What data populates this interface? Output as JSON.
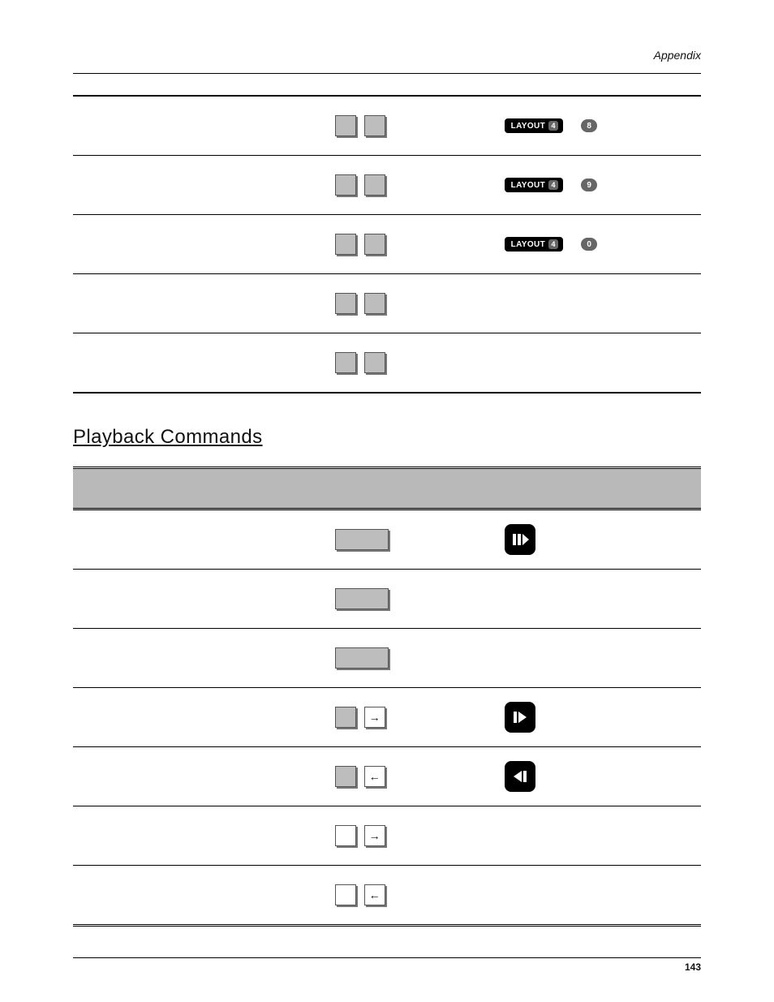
{
  "header": {
    "section": "Appendix"
  },
  "footer": {
    "page": "143"
  },
  "table1": {
    "rows": [
      {
        "remote": {
          "layout": "LAYOUT",
          "layoutNum": "4",
          "num": "8"
        }
      },
      {
        "remote": {
          "layout": "LAYOUT",
          "layoutNum": "4",
          "num": "9"
        }
      },
      {
        "remote": {
          "layout": "LAYOUT",
          "layoutNum": "4",
          "num": "0"
        }
      },
      {
        "remote": null
      },
      {
        "remote": null
      }
    ]
  },
  "playback": {
    "title": "Playback Commands",
    "rows": [
      {
        "key": "wide",
        "icon": "play-pause"
      },
      {
        "key": "wide",
        "icon": null
      },
      {
        "key": "wide",
        "icon": null
      },
      {
        "key": "sq-arrow-right",
        "icon": "step-fwd"
      },
      {
        "key": "sq-arrow-left",
        "icon": "step-back"
      },
      {
        "key": "sqw-arrow-right",
        "icon": null
      },
      {
        "key": "sqw-arrow-left",
        "icon": null
      }
    ]
  }
}
